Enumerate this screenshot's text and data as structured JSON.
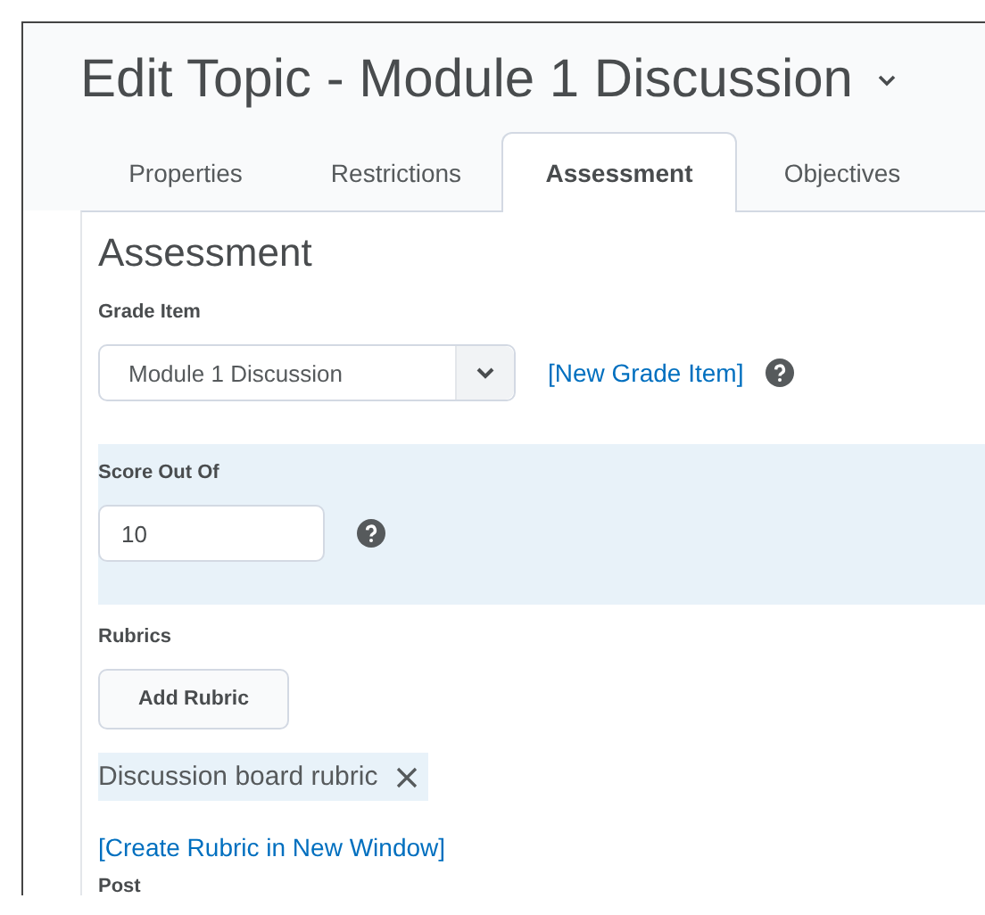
{
  "title": "Edit Topic - Module 1 Discussion",
  "tabs": [
    {
      "label": "Properties",
      "selected": false
    },
    {
      "label": "Restrictions",
      "selected": false
    },
    {
      "label": "Assessment",
      "selected": true
    },
    {
      "label": "Objectives",
      "selected": false
    }
  ],
  "heading": "Assessment",
  "grade_item": {
    "label": "Grade Item",
    "value": "Module 1 Discussion",
    "link": "[New Grade Item]"
  },
  "score": {
    "label": "Score Out Of",
    "value": "10"
  },
  "rubrics": {
    "label": "Rubrics",
    "button": "Add Rubric",
    "items": [
      "Discussion board rubric"
    ],
    "link": "[Create Rubric in New Window]"
  },
  "next_label": "Post"
}
